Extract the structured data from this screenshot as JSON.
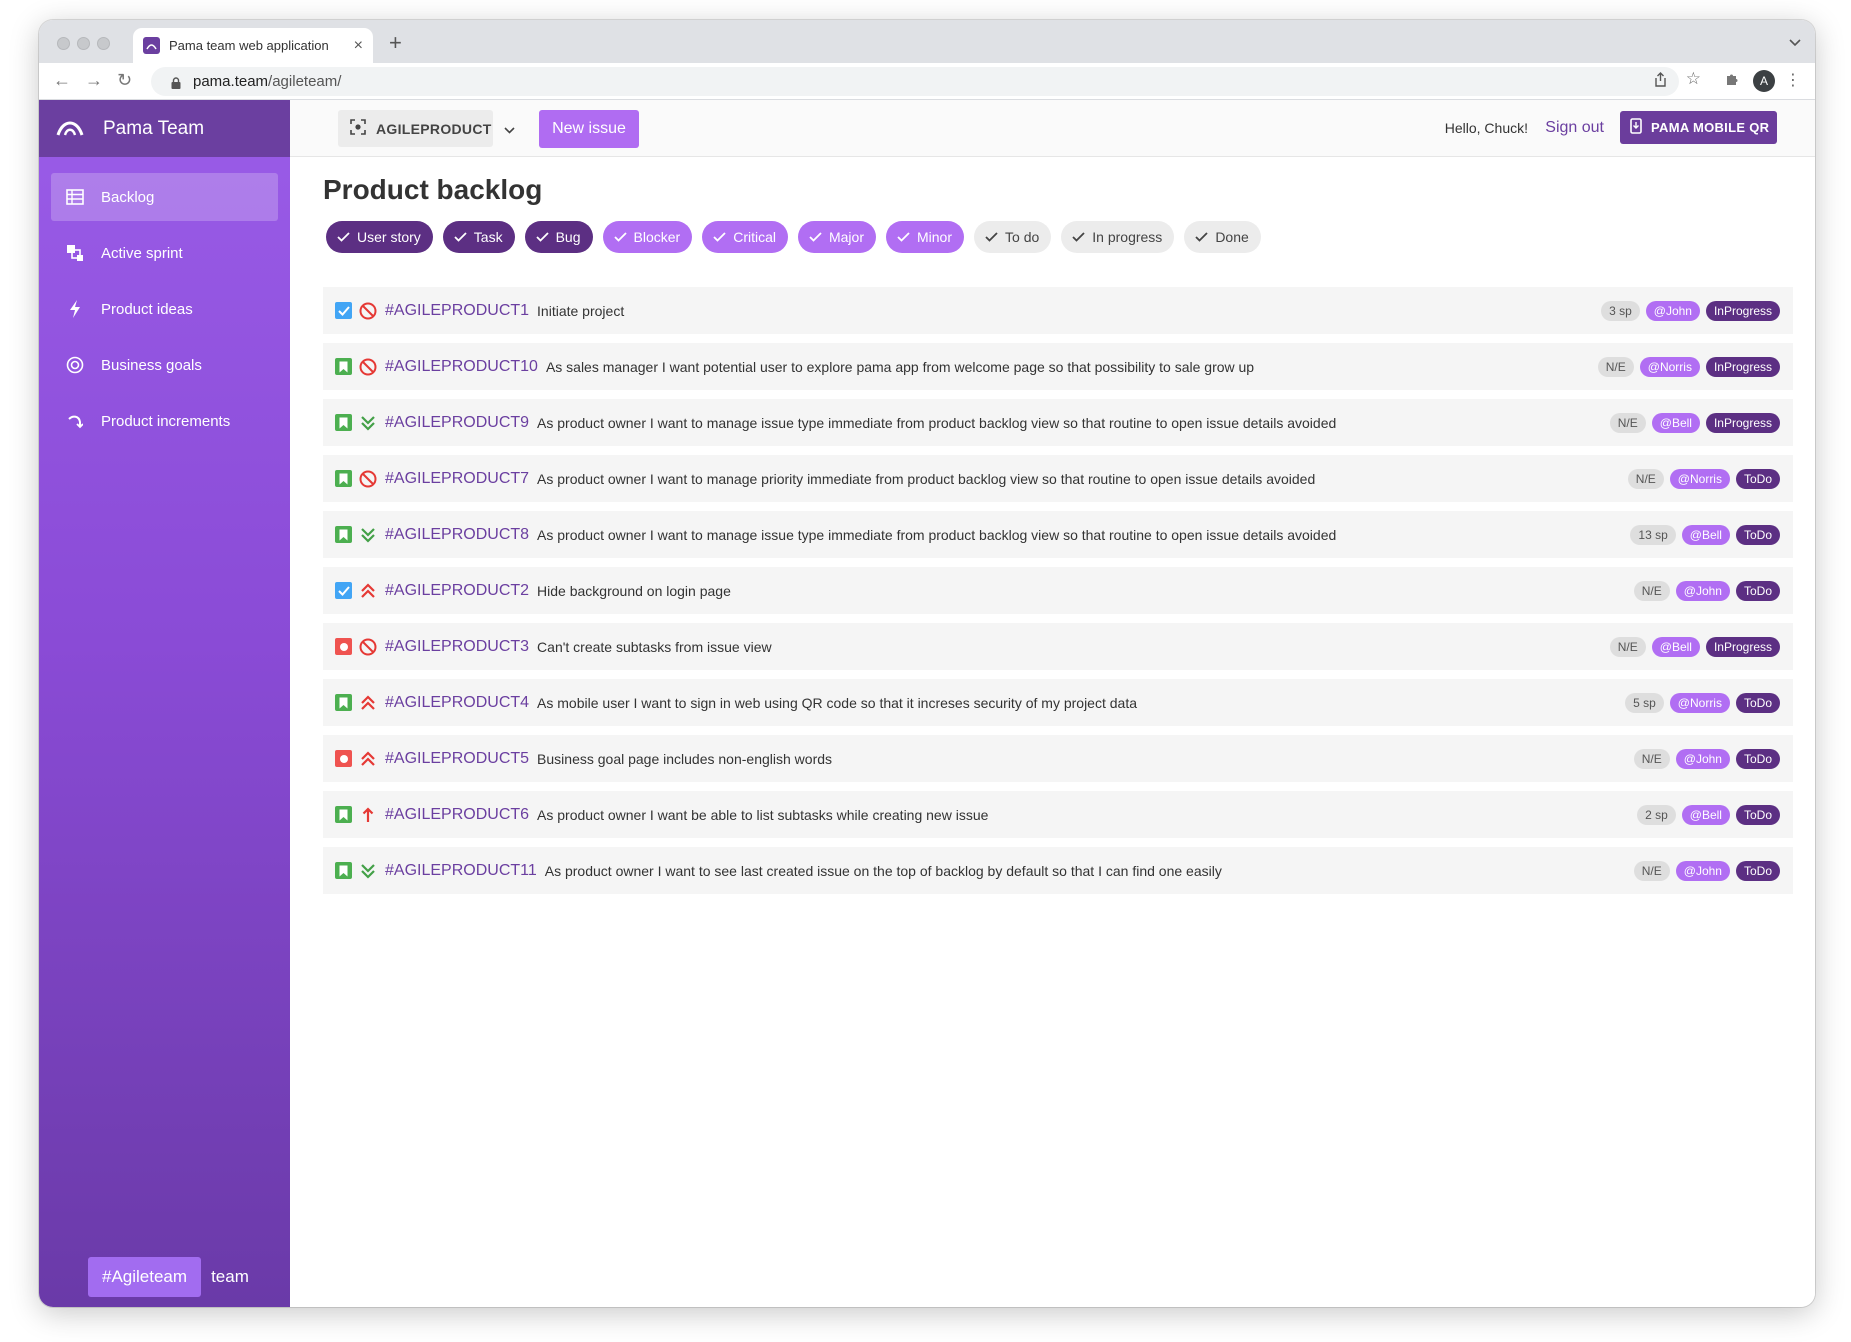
{
  "browser": {
    "tab_title": "Pama team web application",
    "new_tab": "+",
    "url_host": "pama.team",
    "url_path": "/agileteam/",
    "profile_initial": "A"
  },
  "app": {
    "brand": "Pama Team",
    "nav": [
      {
        "label": "Backlog",
        "icon": "table-icon",
        "active": true
      },
      {
        "label": "Active sprint",
        "icon": "sprint-icon",
        "active": false
      },
      {
        "label": "Product ideas",
        "icon": "bolt-icon",
        "active": false
      },
      {
        "label": "Business goals",
        "icon": "target-icon",
        "active": false
      },
      {
        "label": "Product increments",
        "icon": "redo-arrow-icon",
        "active": false
      }
    ],
    "team_chip": "#Agileteam",
    "team_word": "team"
  },
  "topbar": {
    "project": "AGILEPRODUCT",
    "new_issue": "New issue",
    "hello": "Hello, Chuck!",
    "sign_out": "Sign out",
    "mobile_qr": "PAMA MOBILE QR"
  },
  "page": {
    "title": "Product backlog",
    "filters": [
      {
        "label": "User story",
        "style": "dark"
      },
      {
        "label": "Task",
        "style": "dark"
      },
      {
        "label": "Bug",
        "style": "dark"
      },
      {
        "label": "Blocker",
        "style": "light"
      },
      {
        "label": "Critical",
        "style": "light"
      },
      {
        "label": "Major",
        "style": "light"
      },
      {
        "label": "Minor",
        "style": "light"
      },
      {
        "label": "To do",
        "style": "gray"
      },
      {
        "label": "In progress",
        "style": "gray"
      },
      {
        "label": "Done",
        "style": "gray"
      }
    ],
    "issues": [
      {
        "type": "task",
        "priority": "blocker",
        "id": "#AGILEPRODUCT1",
        "title": "Initiate project",
        "sp": "3 sp",
        "user": "@John",
        "status": "InProgress"
      },
      {
        "type": "story",
        "priority": "blocker",
        "id": "#AGILEPRODUCT10",
        "title": "As sales manager I want potential user to explore pama app from welcome page so that possibility to sale grow up",
        "sp": "N/E",
        "user": "@Norris",
        "status": "InProgress"
      },
      {
        "type": "story",
        "priority": "minor",
        "id": "#AGILEPRODUCT9",
        "title": "As product owner I want to manage issue type immediate from product backlog view so that routine to open issue details avoided",
        "sp": "N/E",
        "user": "@Bell",
        "status": "InProgress"
      },
      {
        "type": "story",
        "priority": "blocker",
        "id": "#AGILEPRODUCT7",
        "title": "As product owner I want to manage priority immediate from product backlog view so that routine to open issue details avoided",
        "sp": "N/E",
        "user": "@Norris",
        "status": "ToDo"
      },
      {
        "type": "story",
        "priority": "minor",
        "id": "#AGILEPRODUCT8",
        "title": "As product owner I want to manage issue type immediate from product backlog view so that routine to open issue details avoided",
        "sp": "13 sp",
        "user": "@Bell",
        "status": "ToDo"
      },
      {
        "type": "task",
        "priority": "critical",
        "id": "#AGILEPRODUCT2",
        "title": "Hide background on login page",
        "sp": "N/E",
        "user": "@John",
        "status": "ToDo"
      },
      {
        "type": "bug",
        "priority": "blocker",
        "id": "#AGILEPRODUCT3",
        "title": "Can't create subtasks from issue view",
        "sp": "N/E",
        "user": "@Bell",
        "status": "InProgress"
      },
      {
        "type": "story",
        "priority": "critical",
        "id": "#AGILEPRODUCT4",
        "title": "As mobile user I want to sign in web using QR code so that it increses security of my project data",
        "sp": "5 sp",
        "user": "@Norris",
        "status": "ToDo"
      },
      {
        "type": "bug",
        "priority": "critical",
        "id": "#AGILEPRODUCT5",
        "title": "Business goal page includes non-english words",
        "sp": "N/E",
        "user": "@John",
        "status": "ToDo"
      },
      {
        "type": "story",
        "priority": "major",
        "id": "#AGILEPRODUCT6",
        "title": "As product owner I want be able to list subtasks while creating new issue",
        "sp": "2 sp",
        "user": "@Bell",
        "status": "ToDo"
      },
      {
        "type": "story",
        "priority": "minor",
        "id": "#AGILEPRODUCT11",
        "title": "As product owner I want to see last created issue on the top of backlog by default so that I can find one easily",
        "sp": "N/E",
        "user": "@John",
        "status": "ToDo"
      }
    ]
  },
  "colors": {
    "brand_purple": "#6b3fa0",
    "chip_dark": "#5c2f83",
    "chip_light": "#b16ef3",
    "story_green": "#4caf50",
    "task_blue": "#42a5f5",
    "bug_red": "#ef5350"
  }
}
